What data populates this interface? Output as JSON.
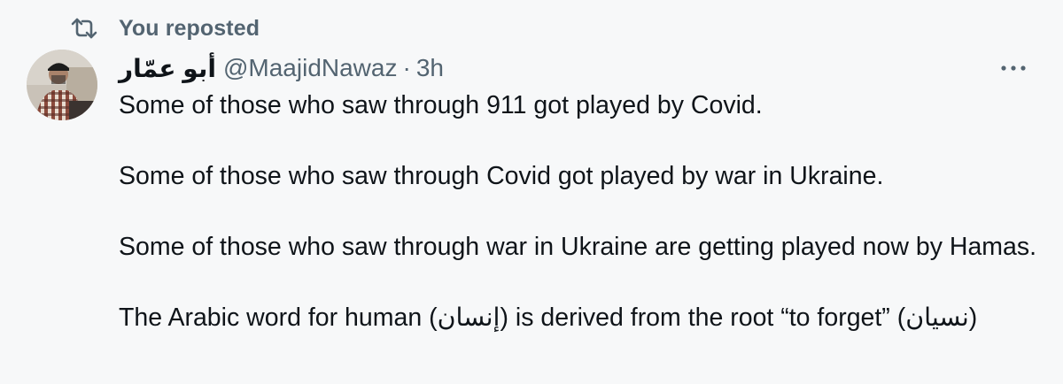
{
  "repost": {
    "icon": "repost-icon",
    "label": "You reposted"
  },
  "author": {
    "avatar_icon": "user-avatar",
    "display_name": "أبو عمّار",
    "handle": "@MaajidNawaz",
    "separator": "·",
    "time": "3h"
  },
  "menu": {
    "icon": "more-options-icon"
  },
  "tweet": {
    "paragraphs": [
      "Some of those who saw through 911 got played by Covid.",
      "Some of those who saw through Covid got played by war in Ukraine.",
      "Some of those who saw through war in Ukraine are getting played now by Hamas.",
      "The Arabic word for human (إنسان) is derived from the root “to forget” (نسيان)"
    ]
  },
  "colors": {
    "background": "#f7f8f9",
    "text_primary": "#0f1419",
    "text_secondary": "#536471"
  }
}
